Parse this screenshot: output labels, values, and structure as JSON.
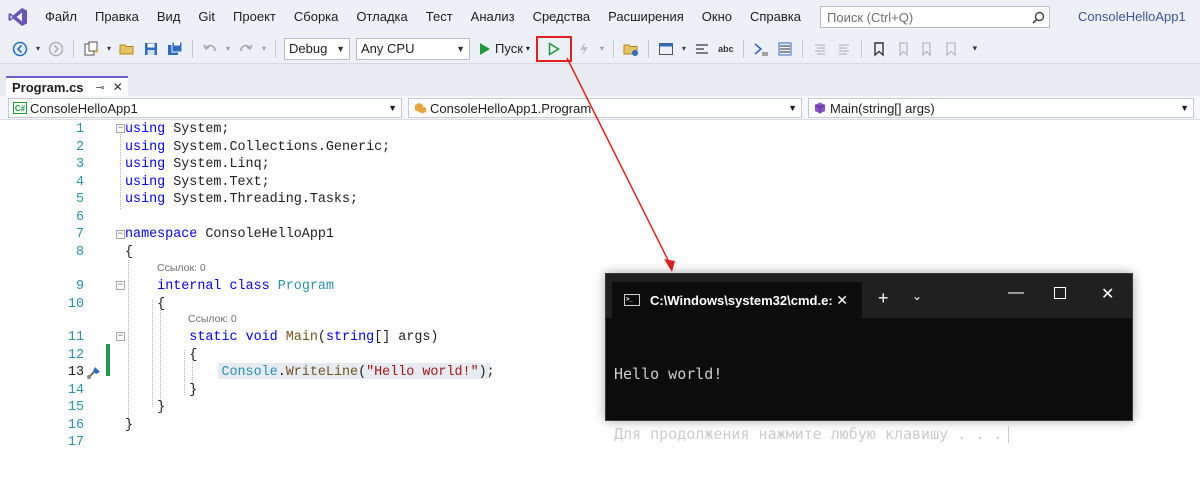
{
  "menubar": {
    "items": [
      "Файл",
      "Правка",
      "Вид",
      "Git",
      "Проект",
      "Сборка",
      "Отладка",
      "Тест",
      "Анализ",
      "Средства",
      "Расширения",
      "Окно",
      "Справка"
    ],
    "search_placeholder": "Поиск (Ctrl+Q)",
    "app_title": "ConsoleHelloApp1"
  },
  "toolbar": {
    "config": "Debug",
    "platform": "Any CPU",
    "start_label": "Пуск"
  },
  "tab": {
    "filename": "Program.cs"
  },
  "navbar": {
    "project": "ConsoleHelloApp1",
    "class": "ConsoleHelloApp1.Program",
    "member": "Main(string[] args)"
  },
  "editor": {
    "line_numbers": [
      "1",
      "2",
      "3",
      "4",
      "5",
      "6",
      "7",
      "8",
      "9",
      "10",
      "11",
      "12",
      "13",
      "14",
      "15",
      "16",
      "17"
    ],
    "refs_hint": "Ссылок: 0",
    "lines": [
      [
        {
          "t": "using",
          "c": "kw"
        },
        {
          "t": " System;",
          "c": ""
        }
      ],
      [
        {
          "t": "using",
          "c": "kw"
        },
        {
          "t": " System.Collections.Generic;",
          "c": ""
        }
      ],
      [
        {
          "t": "using",
          "c": "kw"
        },
        {
          "t": " System.Linq;",
          "c": ""
        }
      ],
      [
        {
          "t": "using",
          "c": "kw"
        },
        {
          "t": " System.Text;",
          "c": ""
        }
      ],
      [
        {
          "t": "using",
          "c": "kw"
        },
        {
          "t": " System.Threading.Tasks;",
          "c": ""
        }
      ],
      [],
      [
        {
          "t": "namespace",
          "c": "kw"
        },
        {
          "t": " ConsoleHelloApp1",
          "c": ""
        }
      ],
      [
        {
          "t": "{",
          "c": ""
        }
      ],
      [
        {
          "t": "    ",
          "c": ""
        },
        {
          "t": "internal",
          "c": "kw"
        },
        {
          "t": " ",
          "c": ""
        },
        {
          "t": "class",
          "c": "kw"
        },
        {
          "t": " ",
          "c": ""
        },
        {
          "t": "Program",
          "c": "ty"
        }
      ],
      [
        {
          "t": "    {",
          "c": ""
        }
      ],
      [
        {
          "t": "        ",
          "c": ""
        },
        {
          "t": "static",
          "c": "kw"
        },
        {
          "t": " ",
          "c": ""
        },
        {
          "t": "void",
          "c": "kw"
        },
        {
          "t": " ",
          "c": ""
        },
        {
          "t": "Main",
          "c": "meth"
        },
        {
          "t": "(",
          "c": ""
        },
        {
          "t": "string",
          "c": "kw"
        },
        {
          "t": "[] args)",
          "c": ""
        }
      ],
      [
        {
          "t": "        {",
          "c": ""
        }
      ],
      [
        {
          "t": "            ",
          "c": ""
        },
        {
          "t": "Console",
          "c": "ty"
        },
        {
          "t": ".",
          "c": ""
        },
        {
          "t": "WriteLine",
          "c": "meth"
        },
        {
          "t": "(",
          "c": ""
        },
        {
          "t": "\"Hello world!\"",
          "c": "str"
        },
        {
          "t": ");",
          "c": ""
        }
      ],
      [
        {
          "t": "        }",
          "c": ""
        }
      ],
      [
        {
          "t": "    }",
          "c": ""
        }
      ],
      [
        {
          "t": "}",
          "c": ""
        }
      ],
      []
    ]
  },
  "console": {
    "title": "C:\\Windows\\system32\\cmd.e:",
    "line1": "Hello world!",
    "line2": "Для продолжения нажмите любую клавишу . . ."
  }
}
